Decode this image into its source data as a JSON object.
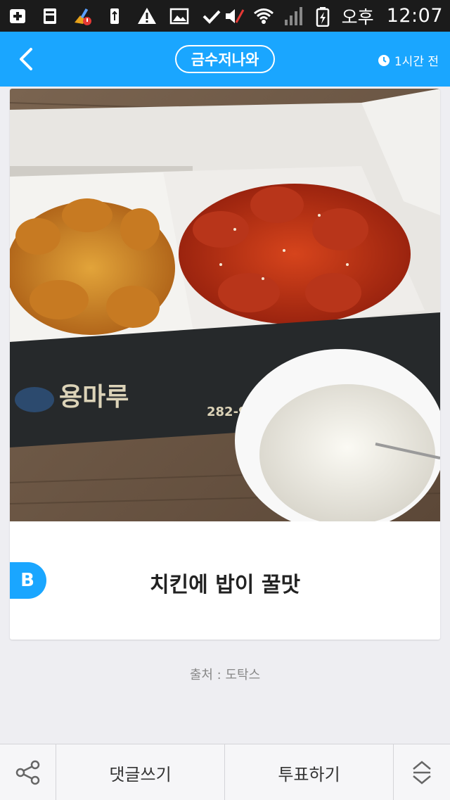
{
  "status_bar": {
    "ampm": "오후",
    "time": "12:07",
    "left_icons": [
      "plus-square-icon",
      "storage-icon",
      "cleaner-icon",
      "usb-icon",
      "warning-icon",
      "image-icon",
      "check-icon"
    ],
    "right_icons": [
      "mute-icon",
      "wifi-icon",
      "signal-icon",
      "battery-charging-icon"
    ]
  },
  "header": {
    "title": "금수저나와",
    "time_ago": "1시간 전",
    "accent_color": "#1aa6ff"
  },
  "post": {
    "badge": "B",
    "caption": "치킨에 밥이 꿀맛",
    "photo_box_text": "용마루",
    "photo_phone_text": "282-99"
  },
  "source": "출처 : 도탁스",
  "bottom_bar": {
    "comment_label": "댓글쓰기",
    "vote_label": "투표하기"
  }
}
